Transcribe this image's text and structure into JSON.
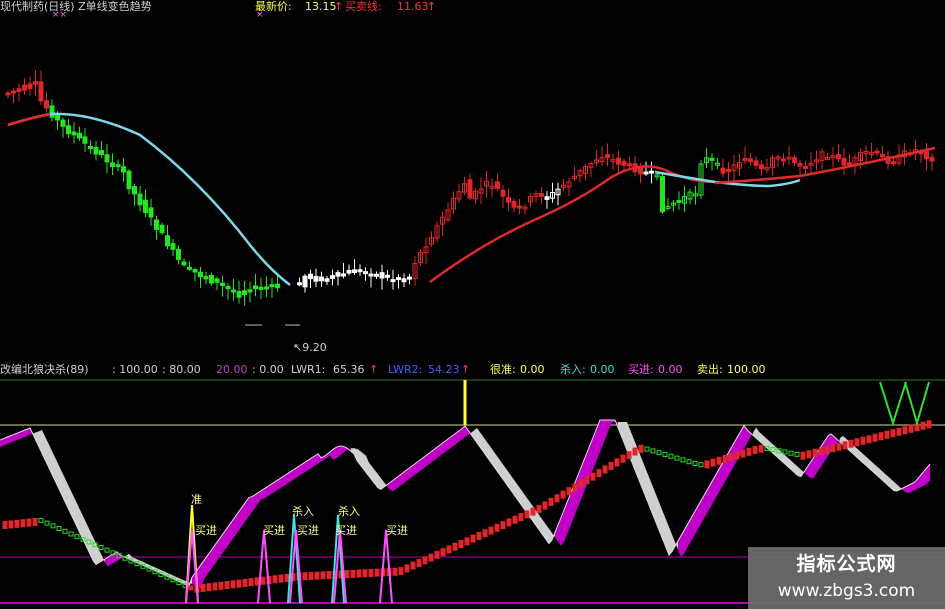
{
  "main_header": {
    "title": "现代制药(日线) Z单线变色趋势",
    "latest_label": "最新价:",
    "latest_value": "13.15",
    "buy_line_label": "买卖线:",
    "buy_line_value": "11.63",
    "arrow": "↑",
    "marks": "××",
    "marks2": "×"
  },
  "price_low_label": "9.20",
  "indicator_header": {
    "name": "改编北狼决杀(89)",
    "v1": ": 100.00",
    "v2": ": 80.00",
    "v3": "20.00",
    "v4": ": 0.00",
    "lwr1_label": "LWR1:",
    "lwr1_value": "65.36",
    "lwr2_label": "LWR2:",
    "lwr2_value": "54.23",
    "henzhun_label": "很准:",
    "henzhun_value": "0.00",
    "shaaru_label": "杀入:",
    "shaaru_value": "0.00",
    "maijin_label": "买进:",
    "maijin_value": "0.00",
    "maichu_label": "卖出:",
    "maichu_value": "100.00",
    "arrow": "↑"
  },
  "signal_labels": {
    "zhun": "准",
    "maijin": "买进",
    "shaaru": "杀入"
  },
  "watermark": {
    "line1": "指标公式网",
    "line2": "www.zbgs3.com"
  },
  "colors": {
    "up": "#e0262b",
    "down": "#22e622",
    "ma_down": "#7fd8e8",
    "ma_up": "#e02a2a",
    "magenta": "#c000c8",
    "grey": "#cfcfcf",
    "yellow_line": "#d8d890",
    "purple_line": "#b400b4"
  }
}
